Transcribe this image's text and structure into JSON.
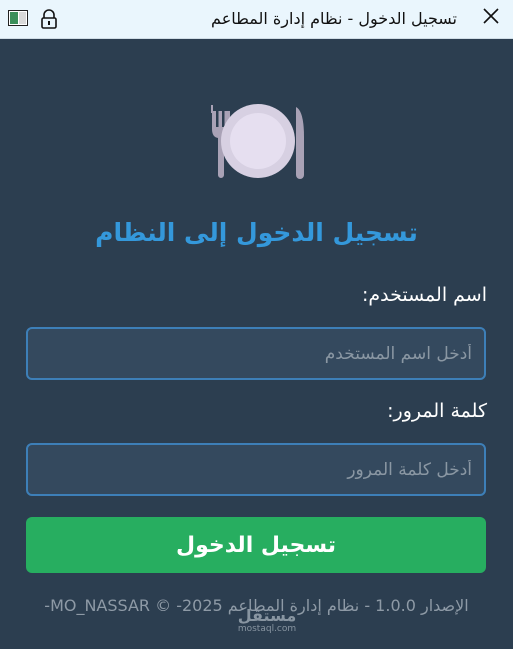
{
  "window": {
    "title": "تسجيل الدخول - نظام إدارة المطاعم",
    "close_icon": "close-icon",
    "lock_icon": "lock-icon",
    "app_icon": "window-app-icon"
  },
  "logo": {
    "icon": "plate-fork-knife-icon"
  },
  "heading": "تسجيل الدخول إلى النظام",
  "username": {
    "label": "اسم المستخدم:",
    "placeholder": "أدخل اسم المستخدم",
    "value": ""
  },
  "password": {
    "label": "كلمة المرور:",
    "placeholder": "أدخل كلمة المرور",
    "value": ""
  },
  "login_button": "تسجيل الدخول",
  "footer": "الإصدار 1.0.0 - نظام إدارة المطاعم 2025- © MO_NASSAR-",
  "watermark": {
    "main": "مستقل",
    "sub": "mostaql.com"
  },
  "colors": {
    "background": "#2c3e50",
    "accent": "#3498db",
    "button": "#27ae60",
    "titlebar": "#eaf6fd"
  }
}
